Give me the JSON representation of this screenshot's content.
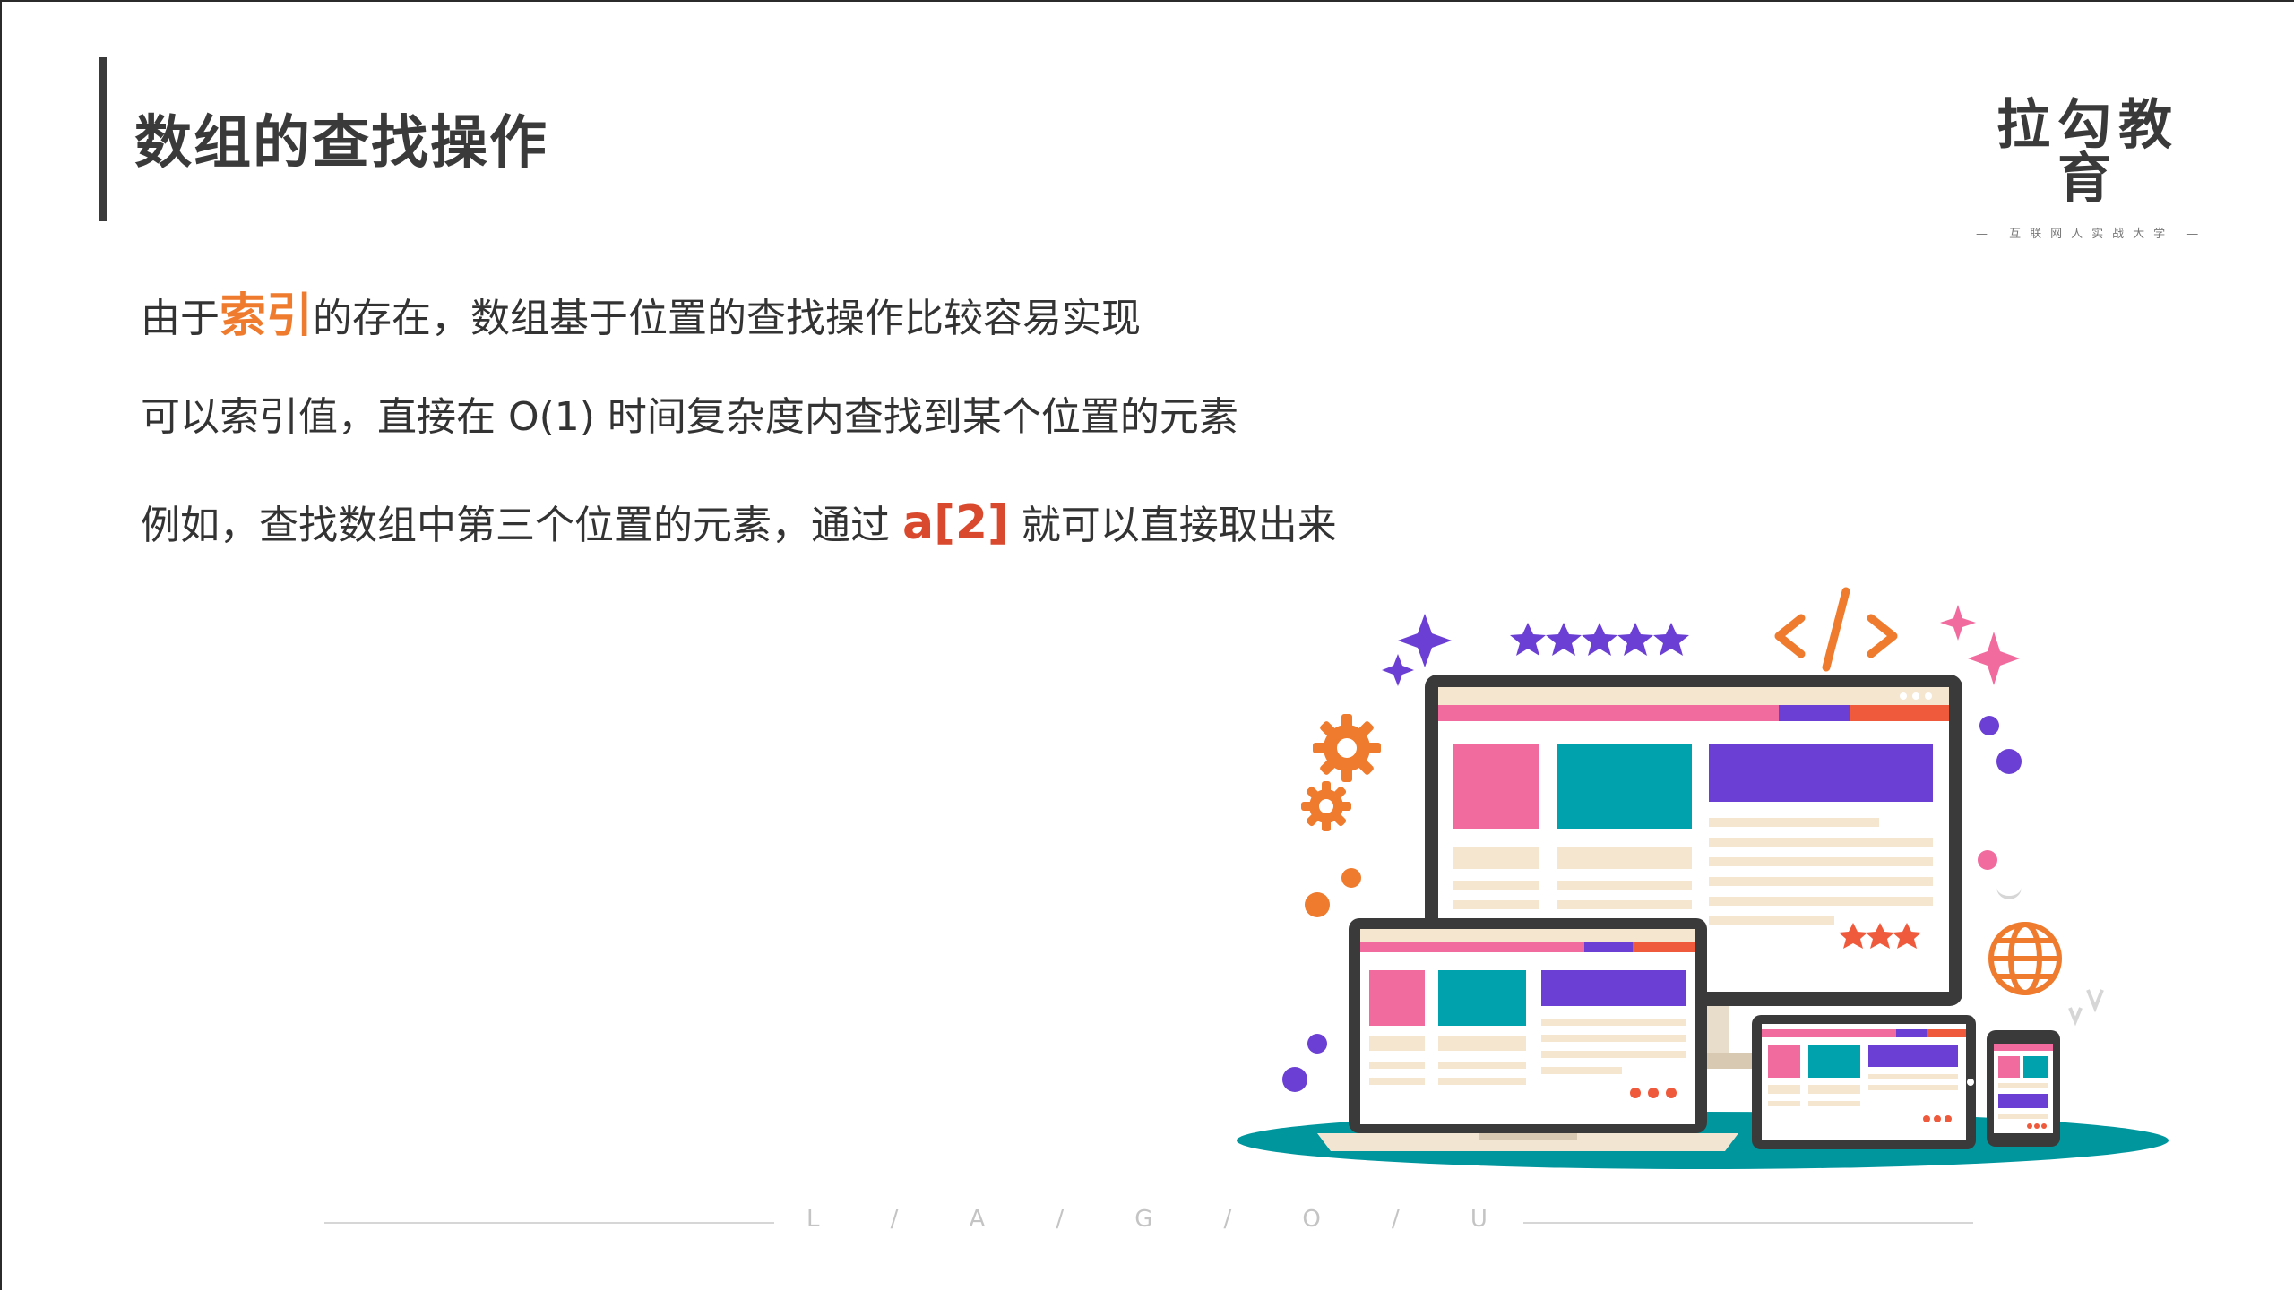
{
  "slide": {
    "title": "数组的查找操作"
  },
  "logo": {
    "name": "拉勾教育",
    "tagline": "— 互联网人实战大学 —"
  },
  "content": {
    "line1": {
      "before": "由于",
      "highlight": "索引",
      "after": "的存在，数组基于位置的查找操作比较容易实现"
    },
    "line2": {
      "text": "可以索引值，直接在 O(1) 时间复杂度内查找到某个位置的元素"
    },
    "line3": {
      "before": "例如，查找数组中第三个位置的元素，通过 ",
      "highlight": "a[2]",
      "after": " 就可以直接取出来"
    }
  },
  "footer": {
    "letters": [
      "L",
      "/",
      "A",
      "/",
      "G",
      "/",
      "O",
      "/",
      "U"
    ]
  },
  "colors": {
    "orange": "#ef7b2e",
    "red": "#d9492e",
    "pink": "#f26b9e",
    "teal": "#00a3ad",
    "purple": "#6b3fd4",
    "dark": "#3a3a3a"
  }
}
